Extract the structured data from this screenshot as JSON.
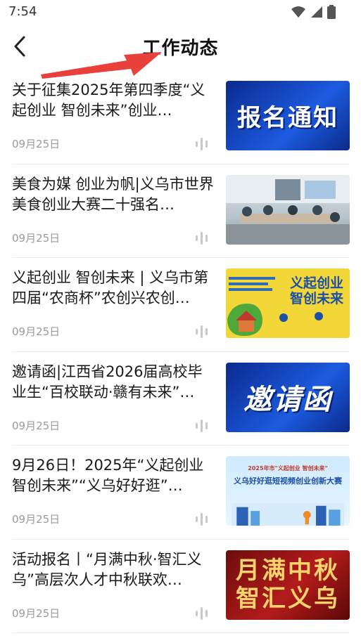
{
  "status_bar": {
    "time": "7:54"
  },
  "header": {
    "title": "工作动态"
  },
  "thumb_texts": {
    "t1": "报名通知",
    "t3_line1": "义起创业",
    "t3_line2": "智创未来",
    "t4": "邀请函",
    "t5_line1": "2025年市\"义起创业 智创未来\"",
    "t5_line2": "义乌好好逛短视频创业创新大赛",
    "t6_line1": "月满中秋",
    "t6_line2": "智汇义乌"
  },
  "articles": [
    {
      "title": "关于征集2025年第四季度“义起创业 智创未来”创业…",
      "date": "09月25日",
      "thumbnail": "report-notice-banner"
    },
    {
      "title": "美食为媒 创业为帆|义乌市世界美食创业大赛二十强名…",
      "date": "09月25日",
      "thumbnail": "meeting-room-photo"
    },
    {
      "title": "义起创业 智创未来 | 义乌市第四届“农商杯”农创兴农创…",
      "date": "09月25日",
      "thumbnail": "agri-poster"
    },
    {
      "title": "邀请函|江西省2026届高校毕业生“百校联动·赣有未来”…",
      "date": "09月25日",
      "thumbnail": "invitation-banner"
    },
    {
      "title": "9月26日！2025年“义起创业 智创未来”“义乌好好逛”…",
      "date": "09月25日",
      "thumbnail": "video-contest-poster"
    },
    {
      "title": "活动报名丨“月满中秋·智汇义乌”高层次人才中秋联欢…",
      "date": "09月25日",
      "thumbnail": "mid-autumn-banner"
    }
  ],
  "colors": {
    "accent_arrow": "#e8403a",
    "date_gray": "#9a9a9a",
    "divider": "#ececec"
  }
}
